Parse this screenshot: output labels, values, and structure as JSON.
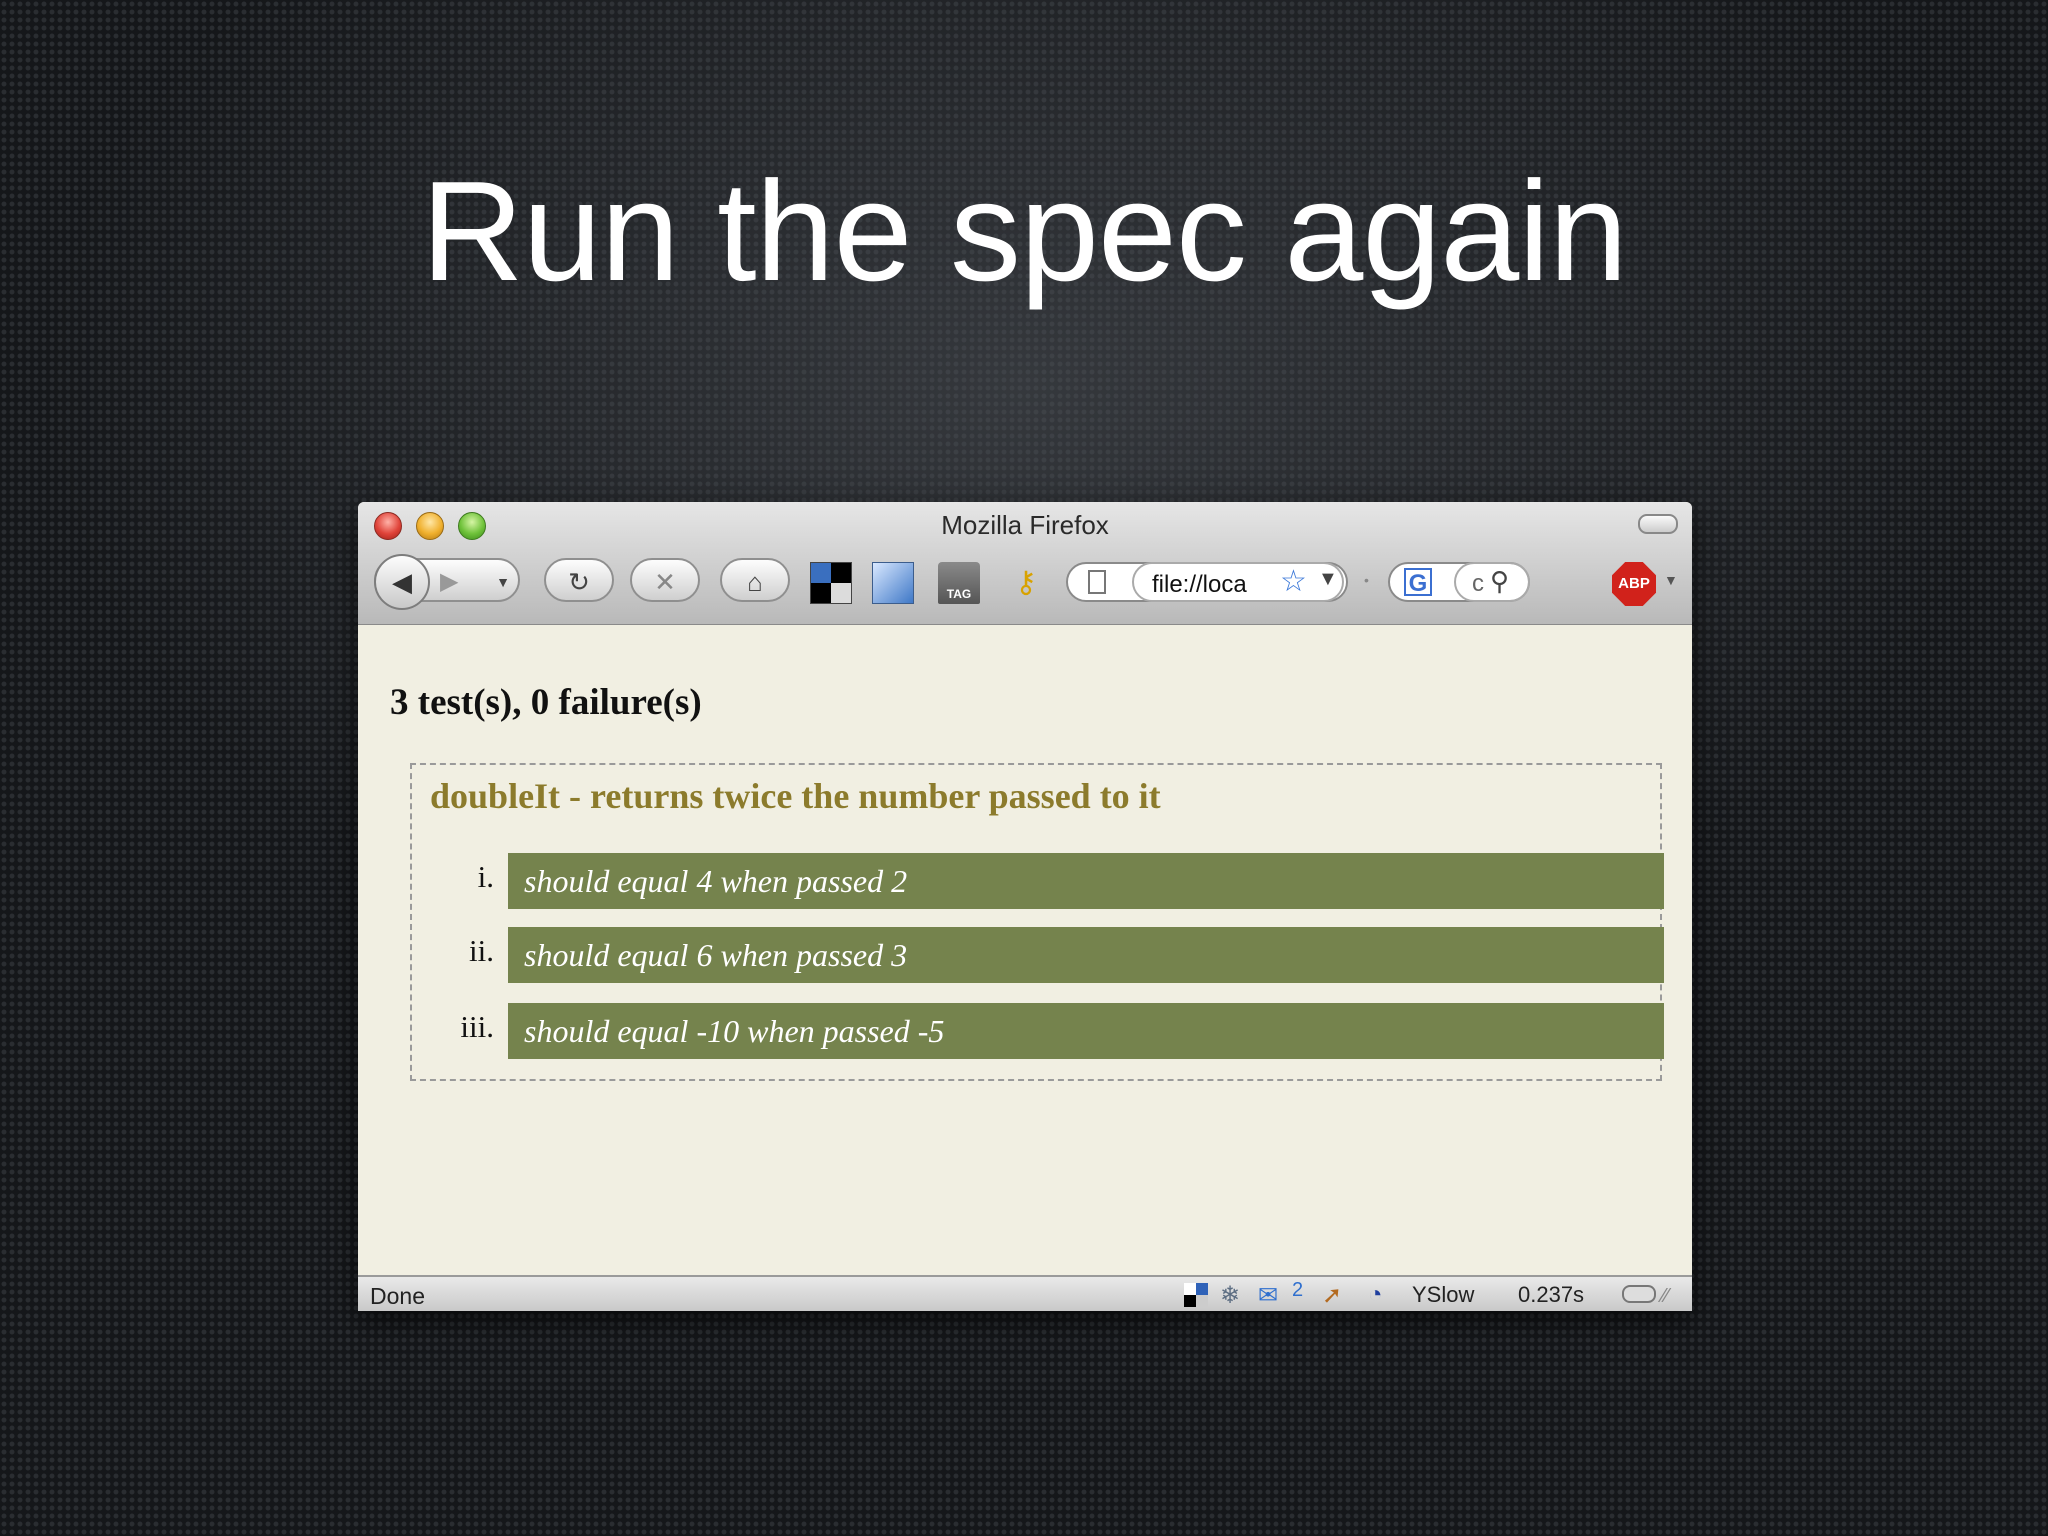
{
  "slide": {
    "title": "Run the spec again"
  },
  "window": {
    "title": "Mozilla Firefox",
    "toolbar": {
      "url": "file://loca",
      "search_text": "c",
      "tag_label": "TAG",
      "abp_label": "ABP"
    }
  },
  "page": {
    "summary": "3 test(s), 0 failure(s)",
    "suite": {
      "title": "doubleIt - returns twice the number passed to it",
      "specs": [
        {
          "num": "i.",
          "text": "should equal 4 when passed 2"
        },
        {
          "num": "ii.",
          "text": "should equal 6 when passed 3"
        },
        {
          "num": "iii.",
          "text": "should equal -10 when passed -5"
        }
      ],
      "pass_color": "#75834d",
      "title_color": "#8c7b2c"
    }
  },
  "statusbar": {
    "status": "Done",
    "mail_count": "2",
    "yslow_label": "YSlow",
    "load_time": "0.237s"
  }
}
